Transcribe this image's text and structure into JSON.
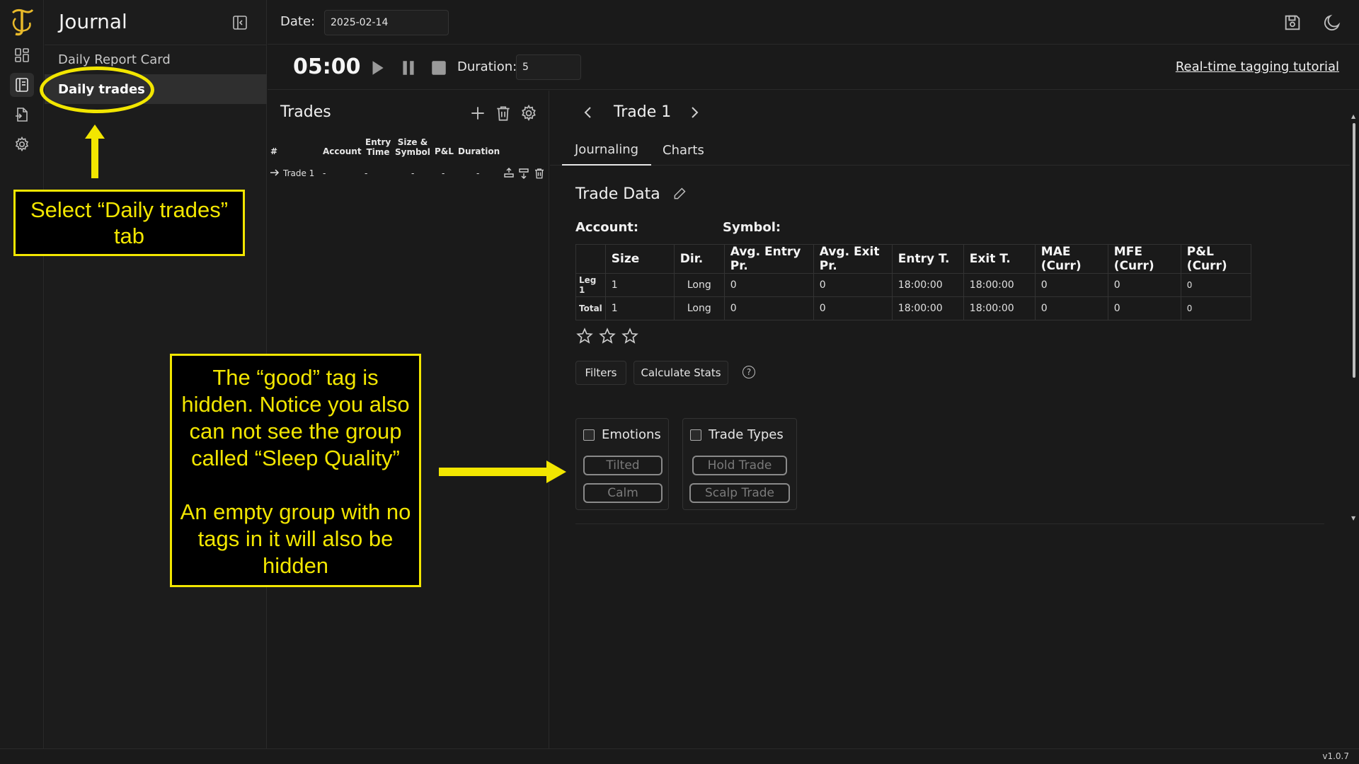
{
  "app": {
    "sidebar_title": "Journal",
    "nav_items": [
      "Daily Report Card",
      "Daily trades"
    ],
    "version": "v1.0.7"
  },
  "topbar": {
    "date_label": "Date:",
    "date_value": "2025-02-14"
  },
  "timer": {
    "time": "05:00",
    "duration_label": "Duration:",
    "duration_value": "5",
    "tutorial_link": "Real-time tagging tutorial"
  },
  "trades": {
    "title": "Trades",
    "columns": [
      "#",
      "Account",
      "Entry\nTime",
      "Size &\nSymbol",
      "P&L",
      "Duration"
    ],
    "rows": [
      {
        "name": "Trade 1",
        "account": "-",
        "entry_time": "-",
        "size_symbol": "-",
        "pnl": "-",
        "duration": "-"
      }
    ]
  },
  "detail": {
    "title": "Trade 1",
    "tabs": [
      "Journaling",
      "Charts"
    ],
    "section_title": "Trade Data",
    "account_label": "Account:",
    "symbol_label": "Symbol:",
    "table_headers": [
      "Size",
      "Dir.",
      "Avg. Entry Pr.",
      "Avg. Exit Pr.",
      "Entry T.",
      "Exit T.",
      "MAE (Curr)",
      "MFE (Curr)",
      "P&L (Curr)"
    ],
    "table_rows": [
      {
        "label": "Leg 1",
        "cells": [
          "1",
          "Long",
          "0",
          "0",
          "18:00:00",
          "18:00:00",
          "0",
          "0",
          "0"
        ]
      },
      {
        "label": "Total",
        "cells": [
          "1",
          "Long",
          "0",
          "0",
          "18:00:00",
          "18:00:00",
          "0",
          "0",
          "0"
        ]
      }
    ],
    "rating_stars": 0,
    "rating_max": 3,
    "filters_button": "Filters",
    "calc_button": "Calculate Stats",
    "help_icon": "?",
    "groups": [
      {
        "name": "Emotions",
        "tags": [
          "Tilted",
          "Calm"
        ]
      },
      {
        "name": "Trade Types",
        "tags": [
          "Hold Trade",
          "Scalp Trade"
        ]
      }
    ]
  },
  "annotations": {
    "select_tab": "Select “Daily trades” tab",
    "note_line1": "The “good” tag is hidden. Notice you also can not see the group called “Sleep Quality”",
    "note_line2": "An empty group with no tags in it will also be hidden",
    "color": "#f2e600"
  }
}
